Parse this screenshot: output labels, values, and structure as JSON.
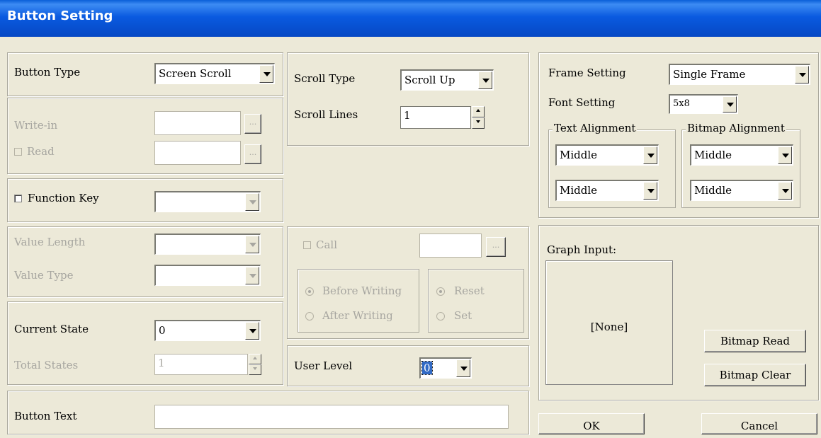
{
  "window": {
    "title": "Button Setting"
  },
  "button_type": {
    "label": "Button Type",
    "value": "Screen Scroll"
  },
  "write_in": {
    "label": "Write-in",
    "value": "",
    "browse": "..."
  },
  "read": {
    "label": "Read",
    "checked": false,
    "value": "",
    "browse": "..."
  },
  "function_key": {
    "label": "Function Key",
    "checked": false,
    "value": ""
  },
  "value_length": {
    "label": "Value Length",
    "value": ""
  },
  "value_type": {
    "label": "Value Type",
    "value": ""
  },
  "current_state": {
    "label": "Current State",
    "value": "0"
  },
  "total_states": {
    "label": "Total States",
    "value": "1"
  },
  "button_text": {
    "label": "Button Text",
    "value": ""
  },
  "scroll_type": {
    "label": "Scroll Type",
    "value": "Scroll Up"
  },
  "scroll_lines": {
    "label": "Scroll Lines",
    "value": "1"
  },
  "call": {
    "label": "Call",
    "checked": false,
    "value": "",
    "browse": "..."
  },
  "writing": {
    "before": "Before Writing",
    "after": "After Writing",
    "selected": "before"
  },
  "reset_set": {
    "reset": "Reset",
    "set": "Set",
    "selected": "reset"
  },
  "user_level": {
    "label": "User Level",
    "value": "0"
  },
  "frame_setting": {
    "label": "Frame Setting",
    "value": "Single Frame"
  },
  "font_setting": {
    "label": "Font Setting",
    "value": "5x8"
  },
  "text_alignment": {
    "legend": "Text Alignment",
    "horizontal": "Middle",
    "vertical": "Middle"
  },
  "bitmap_alignment": {
    "legend": "Bitmap Alignment",
    "horizontal": "Middle",
    "vertical": "Middle"
  },
  "graph_input": {
    "label": "Graph Input:",
    "preview": "[None]"
  },
  "buttons": {
    "bitmap_read": "Bitmap Read",
    "bitmap_clear": "Bitmap Clear",
    "ok": "OK",
    "cancel": "Cancel"
  }
}
